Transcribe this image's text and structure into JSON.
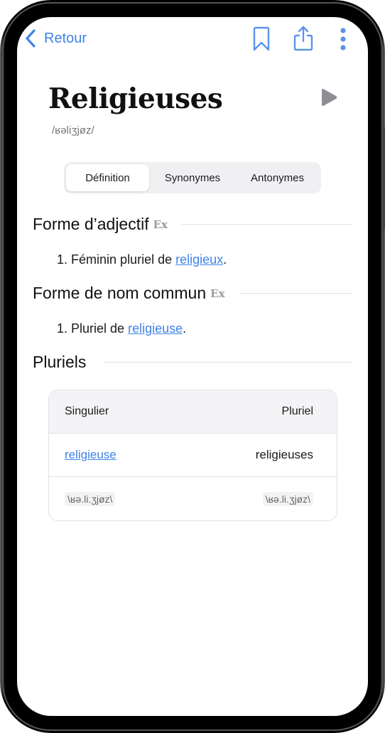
{
  "nav": {
    "back_label": "Retour",
    "icons": [
      "chevron-left-icon",
      "bookmark-icon",
      "share-icon",
      "more-vertical-icon"
    ]
  },
  "entry": {
    "headword": "Religieuses",
    "phonetic": "/ʁəliʒjøz/",
    "play_icon": "play-icon"
  },
  "tabs": [
    {
      "label": "Définition",
      "active": true
    },
    {
      "label": "Synonymes",
      "active": false
    },
    {
      "label": "Antonymes",
      "active": false
    }
  ],
  "sections": [
    {
      "title": "Forme d’adjectif",
      "badge": "Ex",
      "definitions": [
        {
          "number": "1.",
          "text": "Féminin pluriel de ",
          "link": "religieux",
          "suffix": "."
        }
      ]
    },
    {
      "title": "Forme de nom commun",
      "badge": "Ex",
      "definitions": [
        {
          "number": "1.",
          "text": "Pluriel de ",
          "link": "religieuse",
          "suffix": "."
        }
      ]
    },
    {
      "title": "Pluriels"
    }
  ],
  "plural_table": {
    "headers": [
      "Singulier",
      "Pluriel"
    ],
    "rows": [
      [
        "religieuse",
        "religieuses"
      ],
      [
        "\\ʁə.li.ʒjøz\\",
        "\\ʁə.li.ʒjøz\\"
      ]
    ]
  },
  "colors": {
    "accent": "#3f83e8",
    "text": "#111111",
    "muted": "#777777",
    "play": "#8e8e93"
  }
}
